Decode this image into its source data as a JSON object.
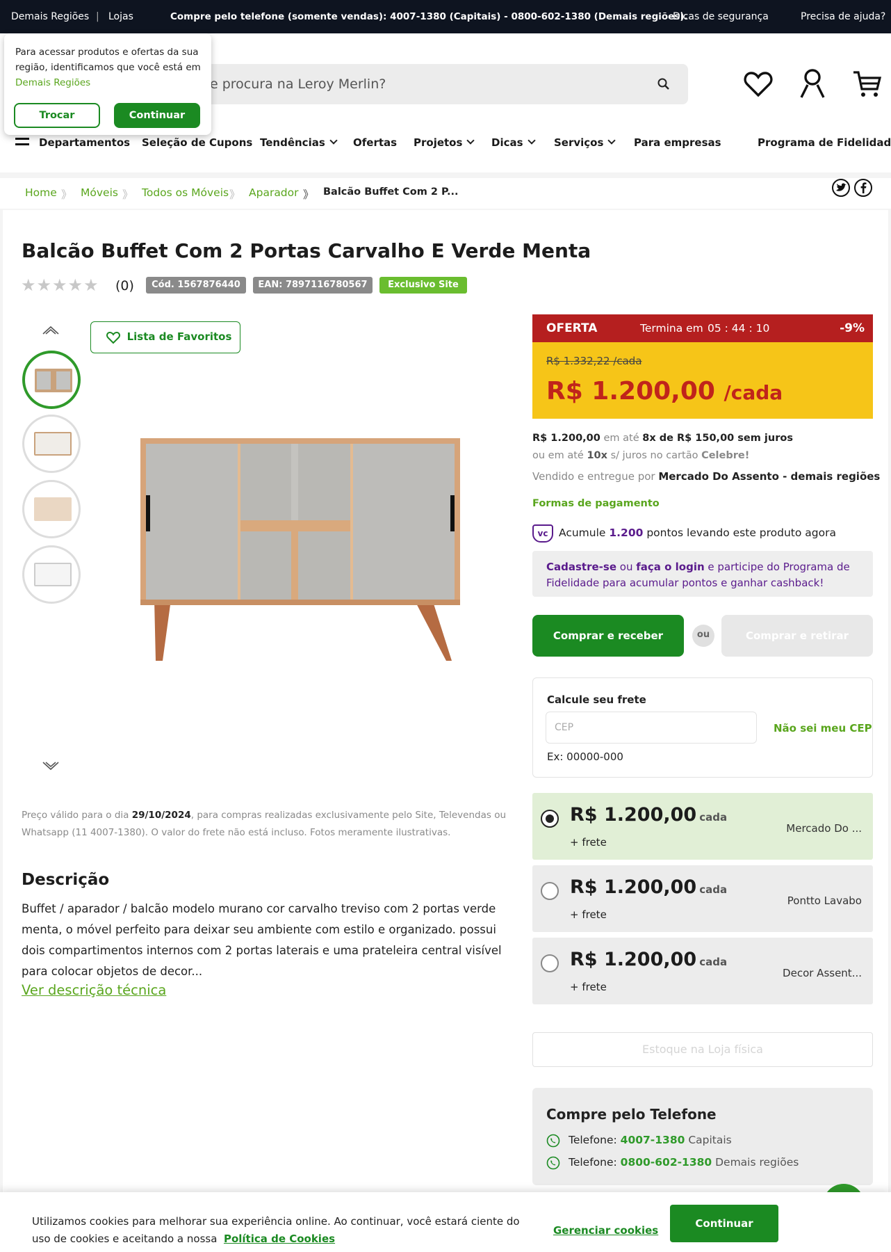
{
  "topbar": {
    "region": "Demais Regiões",
    "separator": "|",
    "stores": "Lojas",
    "phone_info": "Compre pelo telefone (somente vendas): 4007-1380 (Capitais) - 0800-602-1380 (Demais regiões).",
    "security_tips": "Dicas de segurança",
    "help": "Precisa de ajuda?"
  },
  "popup": {
    "message": "Para acessar produtos e ofertas da sua região, identificamos que você está em",
    "region": "Demais Regiões",
    "change_label": "Trocar",
    "continue_label": "Continuar"
  },
  "search": {
    "placeholder_visible": "e procura na Leroy Merlin?"
  },
  "nav": {
    "departments": "Departamentos",
    "items": [
      "Seleção de Cupons",
      "Tendências",
      "Ofertas",
      "Projetos",
      "Dicas",
      "Serviços",
      "Para empresas",
      "Programa de Fidelidade"
    ]
  },
  "breadcrumb": {
    "items": [
      "Home",
      "Móveis",
      "Todos os Móveis",
      "Aparador"
    ],
    "current": "Balcão Buffet Com 2 P...",
    "separator": "》"
  },
  "product": {
    "title": "Balcão Buffet Com 2 Portas Carvalho E Verde Menta",
    "stars": "★★★★★",
    "rating_count": "(0)",
    "code": "Cód. 1567876440",
    "ean": "EAN: 7897116780567",
    "exclusive": "Exclusivo Site",
    "favorites_label": "Lista de Favoritos",
    "validity_note": {
      "prefix": "Preço válido para o dia ",
      "date": "29/10/2024",
      "suffix": ", para compras realizadas exclusivamente pelo Site, Televendas ou Whatsapp (11 4007-1380). O valor do frete não está incluso. Fotos meramente ilustrativas."
    },
    "description_title": "Descrição",
    "description": "Buffet / aparador / balcão modelo murano cor carvalho treviso com 2 portas verde menta, o móvel perfeito para deixar seu ambiente com estilo e organizado. possui dois compartimentos internos com 2 portas laterais e uma prateleira central visível para colocar objetos de decor...",
    "technical_link": "Ver descrição técnica"
  },
  "offer": {
    "label": "OFERTA",
    "timer_prefix": "Termina em",
    "timer": "05 : 44 : 10",
    "discount": "-9%",
    "old_price": "R$ 1.332,22 /cada",
    "price": "R$ 1.200,00",
    "unit": "/cada",
    "installments": {
      "price": "R$ 1.200,00",
      "mid": " em até ",
      "plan": "8x de R$ 150,00 sem juros"
    },
    "card": {
      "prefix": "ou em até ",
      "times": "10x",
      "mid": " s/ juros no cartão ",
      "brand": "Celebre!"
    },
    "seller": {
      "prefix": "Vendido e entregue por ",
      "name": "Mercado Do Assento - demais regiões"
    },
    "payment_link": "Formas de pagamento",
    "points": {
      "badge": "vc",
      "prefix": "Acumule ",
      "value": "1.200",
      "suffix": " pontos levando este produto agora"
    },
    "loyalty": {
      "signup": "Cadastre-se",
      "or": " ou ",
      "login": "faça o login",
      "rest": " e participe do Programa de Fidelidade para acumular pontos e ganhar cashback!"
    },
    "buy_receive": "Comprar e receber",
    "or_label": "ou",
    "buy_pickup": "Comprar e retirar"
  },
  "shipping": {
    "title": "Calcule seu frete",
    "placeholder": "CEP",
    "dont_know": "Não sei meu CEP",
    "example": "Ex: 00000-000"
  },
  "sellers": [
    {
      "price": "R$ 1.200,00",
      "unit": "cada",
      "freight": "+ frete",
      "name": "Mercado Do ..."
    },
    {
      "price": "R$ 1.200,00",
      "unit": "cada",
      "freight": "+ frete",
      "name": "Pontto Lavabo"
    },
    {
      "price": "R$ 1.200,00",
      "unit": "cada",
      "freight": "+ frete",
      "name": "Decor Assent..."
    }
  ],
  "stock_button": "Estoque na Loja física",
  "phone_box": {
    "title": "Compre pelo Telefone",
    "lines": [
      {
        "label": "Telefone: ",
        "number": "4007-1380",
        "region": " Capitais"
      },
      {
        "label": "Telefone: ",
        "number": "0800-602-1380",
        "region": " Demais regiões"
      }
    ]
  },
  "cookie": {
    "text": "Utilizamos cookies para melhorar sua experiência online. Ao continuar, você estará ciente do uso de cookies e aceitando a nossa",
    "policy_link": "Política de Cookies",
    "manage": "Gerenciar cookies",
    "continue": "Continuar"
  },
  "colors": {
    "brand_green": "#1b8a22",
    "link_green": "#5aa61e",
    "offer_red": "#b51f1f",
    "offer_yellow": "#f6c518",
    "loyalty_purple": "#5a1b8c"
  }
}
